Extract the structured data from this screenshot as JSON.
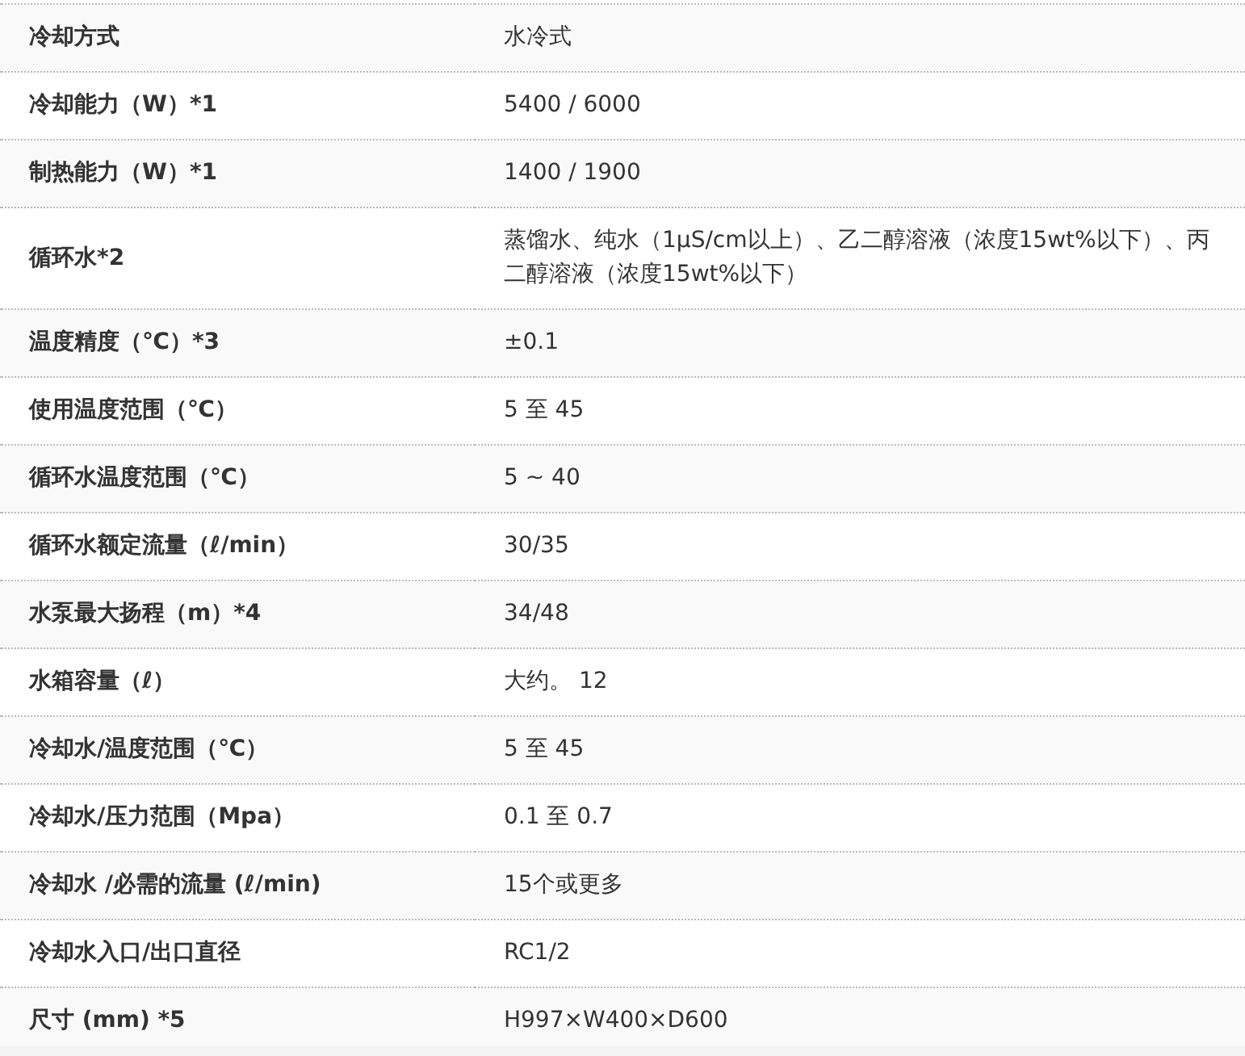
{
  "spec_table": {
    "rows": [
      {
        "label": "冷却方式",
        "value": "水冷式"
      },
      {
        "label": "冷却能力（W）*1",
        "value": "5400 / 6000"
      },
      {
        "label": "制热能力（W）*1",
        "value": "1400 / 1900"
      },
      {
        "label": "循环水*2",
        "value": "蒸馏水、纯水（1μS/cm以上）、乙二醇溶液（浓度15wt%以下）、丙二醇溶液（浓度15wt%以下）"
      },
      {
        "label": "温度精度（℃）*3",
        "value": "±0.1"
      },
      {
        "label": "使用温度范围（℃）",
        "value": "5 至 45"
      },
      {
        "label": "循环水温度范围（℃）",
        "value": "5 ~ 40"
      },
      {
        "label": "循环水额定流量（ℓ/min）",
        "value": "30/35"
      },
      {
        "label": "水泵最大扬程（m）*4",
        "value": "34/48"
      },
      {
        "label": "水箱容量（ℓ）",
        "value": "大约。 12"
      },
      {
        "label": "冷却水/温度范围（℃）",
        "value": "5 至 45"
      },
      {
        "label": "冷却水/压力范围（Mpa）",
        "value": "0.1 至 0.7"
      },
      {
        "label": "冷却水 /必需的流量 (ℓ/min)",
        "value": "15个或更多"
      },
      {
        "label": "冷却水入口/出口直径",
        "value": "RC1/2"
      },
      {
        "label": "尺寸 (mm) *5",
        "value": "H997×W400×D600"
      }
    ]
  }
}
